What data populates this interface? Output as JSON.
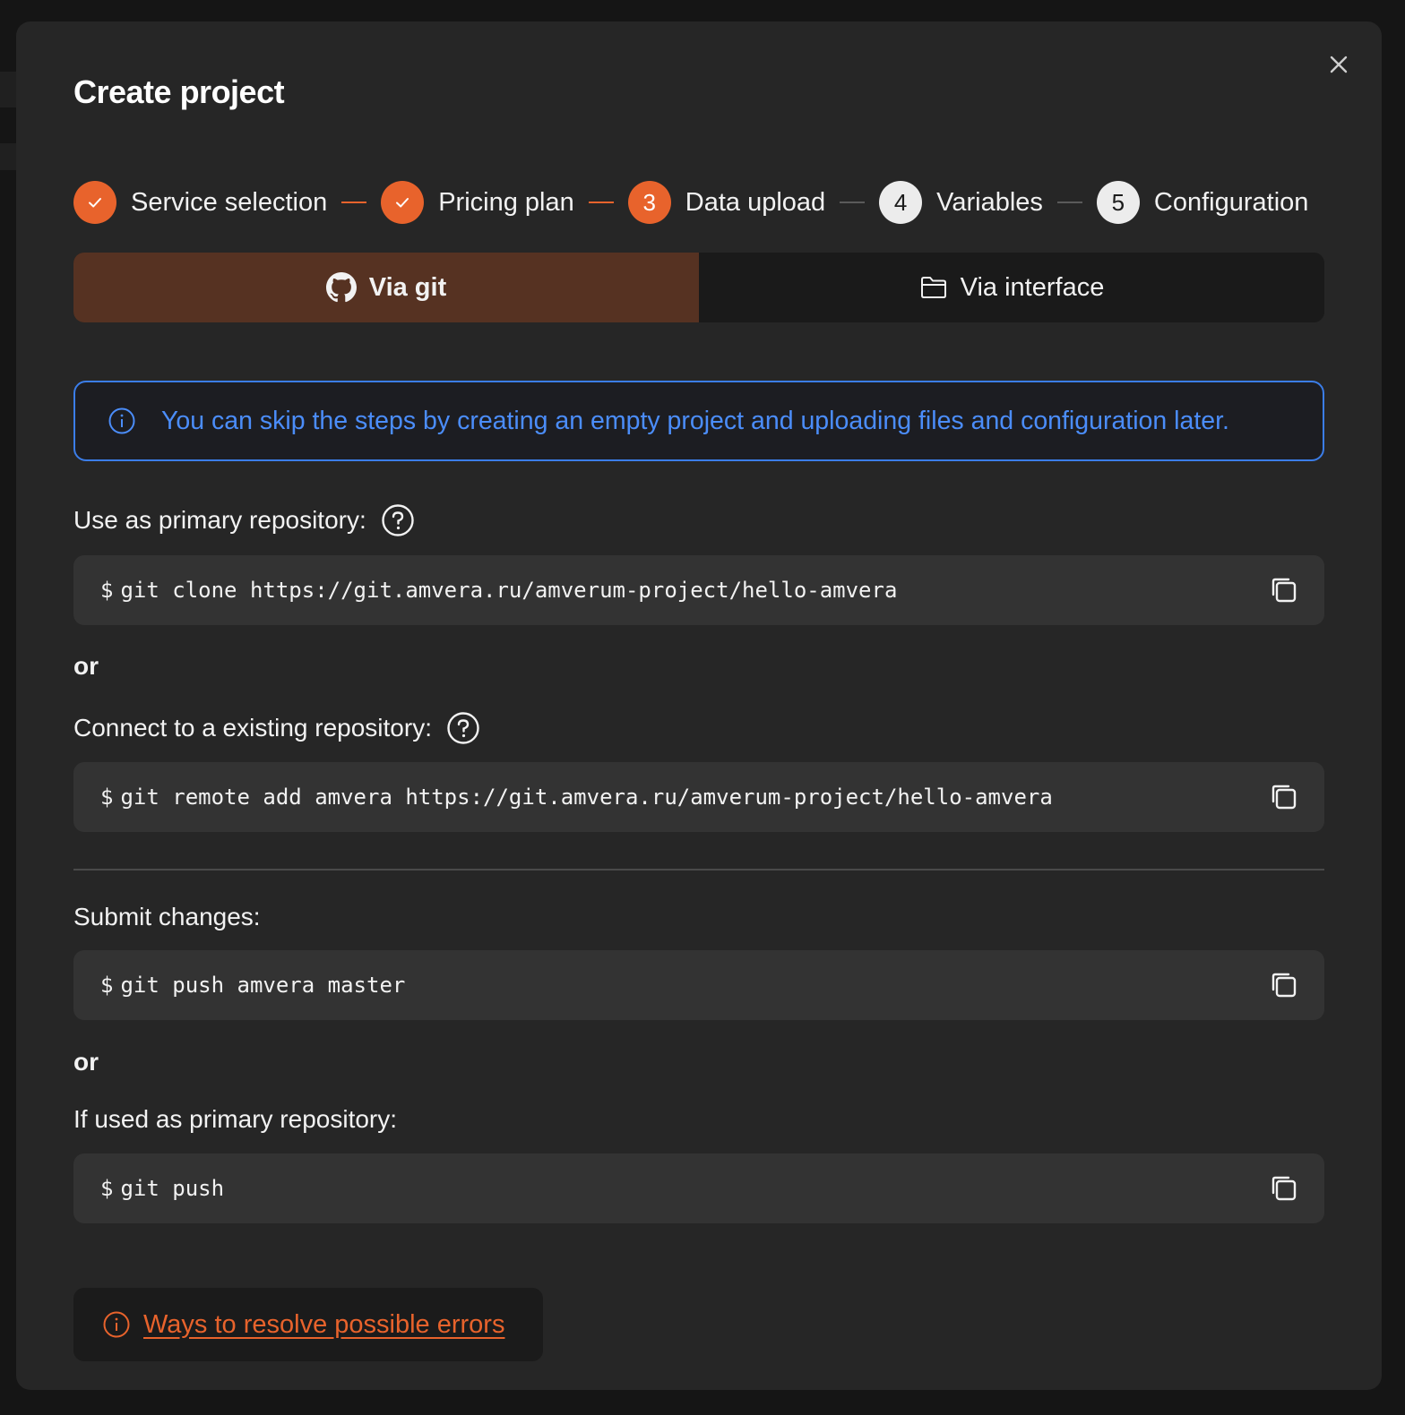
{
  "modal": {
    "title": "Create project"
  },
  "stepper": {
    "steps": [
      {
        "number": "",
        "label": "Service selection",
        "state": "done"
      },
      {
        "number": "",
        "label": "Pricing plan",
        "state": "done"
      },
      {
        "number": "3",
        "label": "Data upload",
        "state": "active"
      },
      {
        "number": "4",
        "label": "Variables",
        "state": "pending"
      },
      {
        "number": "5",
        "label": "Configuration",
        "state": "pending"
      }
    ]
  },
  "tabs": {
    "via_git": "Via git",
    "via_interface": "Via interface",
    "selected": "via_git"
  },
  "info": {
    "text": "You can skip the steps by creating an empty project and uploading files and configuration later."
  },
  "sections": {
    "primary_label": "Use as primary repository:",
    "clone_cmd": "git clone https://git.amvera.ru/amverum-project/hello-amvera",
    "or_1": "or",
    "existing_label": "Connect to a existing repository:",
    "remote_cmd": "git remote add amvera https://git.amvera.ru/amverum-project/hello-amvera",
    "submit_label": "Submit changes:",
    "push_cmd": "git push amvera master",
    "or_2": "or",
    "if_primary_label": "If used as primary repository:",
    "push_primary_cmd": "git push",
    "prompt": "$"
  },
  "footer": {
    "errors_link": "Ways to resolve possible errors"
  },
  "colors": {
    "accent": "#e8632c",
    "info_blue": "#4b8dfa",
    "modal_bg": "#262626",
    "code_bg": "#333333"
  },
  "icons": {
    "close": "close-icon",
    "check": "check-icon",
    "github": "github-icon",
    "folder": "folder-icon",
    "info": "info-circle-icon",
    "help": "question-circle-icon",
    "copy": "copy-icon"
  }
}
